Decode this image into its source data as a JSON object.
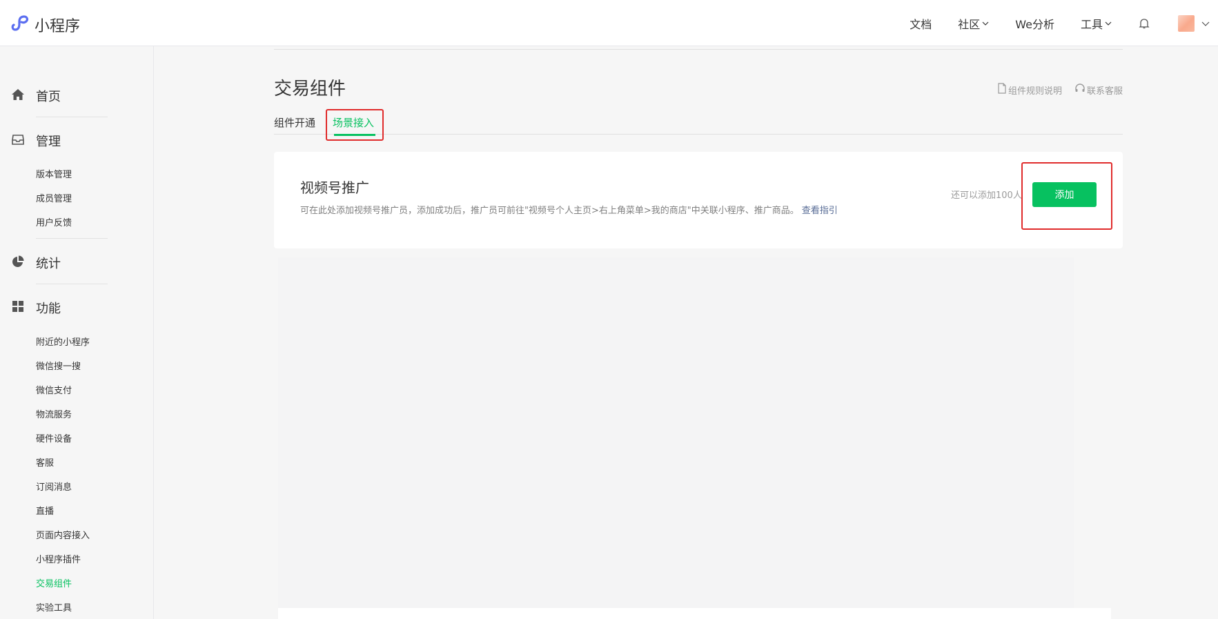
{
  "header": {
    "logo_text": "小程序",
    "nav": [
      {
        "label": "文档",
        "dropdown": false
      },
      {
        "label": "社区",
        "dropdown": true
      },
      {
        "label": "We分析",
        "dropdown": false
      },
      {
        "label": "工具",
        "dropdown": true
      }
    ],
    "icons": [
      "miniprogram-logo-icon",
      "bell-icon",
      "avatar",
      "chevron-down-icon"
    ]
  },
  "sidebar": {
    "groups": [
      {
        "label": "首页",
        "icon": "home-icon"
      },
      {
        "label": "管理",
        "icon": "inbox-icon",
        "items": [
          "版本管理",
          "成员管理",
          "用户反馈"
        ]
      },
      {
        "label": "统计",
        "icon": "pie-chart-icon"
      },
      {
        "label": "功能",
        "icon": "grid-icon",
        "items": [
          "附近的小程序",
          "微信搜一搜",
          "微信支付",
          "物流服务",
          "硬件设备",
          "客服",
          "订阅消息",
          "直播",
          "页面内容接入",
          "小程序插件",
          "交易组件",
          "实验工具"
        ]
      }
    ],
    "active_item": "交易组件"
  },
  "main": {
    "title": "交易组件",
    "help_links": [
      {
        "label": "组件规则说明",
        "icon": "document-icon"
      },
      {
        "label": "联系客服",
        "icon": "headset-icon"
      }
    ],
    "tabs": [
      {
        "label": "组件开通",
        "active": false
      },
      {
        "label": "场景接入",
        "active": true
      }
    ],
    "card": {
      "title": "视频号推广",
      "description": "可在此处添加视频号推广员，添加成功后，推广员可前往\"视频号个人主页>右上角菜单>我的商店\"中关联小程序、推广商品。",
      "link": "查看指引",
      "remaining": "还可以添加100人",
      "button": "添加"
    }
  },
  "colors": {
    "accent": "#07c160",
    "link": "#576b95",
    "highlight": "#e02b2b",
    "background": "#f6f6f6"
  }
}
